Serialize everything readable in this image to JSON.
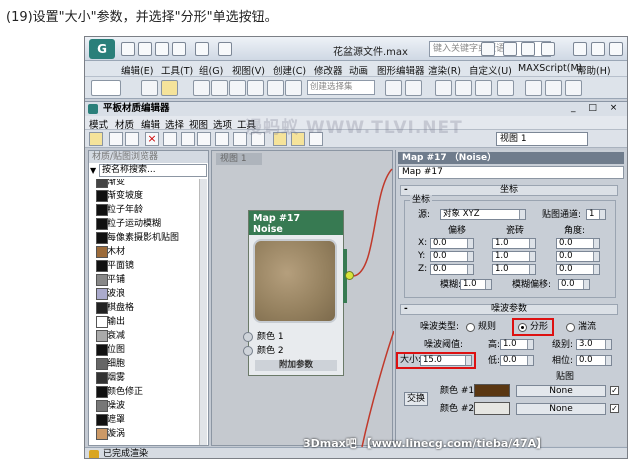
{
  "caption": "(19)设置\"大小\"参数，并选择\"分形\"单选按钮。",
  "app": {
    "logo": "G",
    "filename": "花盆源文件.max",
    "help_search_placeholder": "键入关键字或短语"
  },
  "main_menu": [
    "编辑(E)",
    "工具(T)",
    "组(G)",
    "视图(V)",
    "创建(C)",
    "修改器",
    "动画",
    "图形编辑器",
    "渲染(R)",
    "自定义(U)",
    "MAXScript(M)",
    "帮助(H)"
  ],
  "selection_set_placeholder": "创建选择集",
  "slate": {
    "title": "平板材质编辑器",
    "menu": [
      "模式",
      "材质",
      "编辑",
      "选择",
      "视图",
      "选项",
      "工具"
    ],
    "view_dropdown": "视图 1"
  },
  "browser": {
    "title": "材质/贴图浏览器",
    "search_placeholder": "按名称搜索...",
    "items": [
      {
        "label": "渐变",
        "color": "#444"
      },
      {
        "label": "渐变坡度",
        "color": "#111"
      },
      {
        "label": "粒子年龄",
        "color": "#111"
      },
      {
        "label": "粒子运动模糊",
        "color": "#111"
      },
      {
        "label": "每像素摄影机贴图",
        "color": "#111"
      },
      {
        "label": "木材",
        "color": "#9c6b3a"
      },
      {
        "label": "平面镜",
        "color": "#111"
      },
      {
        "label": "平铺",
        "color": "#888"
      },
      {
        "label": "波浪",
        "color": "#aac"
      },
      {
        "label": "棋盘格",
        "color": "#222"
      },
      {
        "label": "输出",
        "color": "#fff"
      },
      {
        "label": "衰减",
        "color": "#aaa"
      },
      {
        "label": "位图",
        "color": "#111"
      },
      {
        "label": "细胞",
        "color": "#666"
      },
      {
        "label": "烟雾",
        "color": "#333"
      },
      {
        "label": "颜色修正",
        "color": "#111"
      },
      {
        "label": "噪波",
        "color": "#777"
      },
      {
        "label": "遮罩",
        "color": "#111"
      },
      {
        "label": "漩涡",
        "color": "#c96"
      }
    ]
  },
  "node_view": {
    "tab": "视图 1"
  },
  "node": {
    "title": "Map #17",
    "subtitle": "Noise",
    "slots": [
      "颜色 1",
      "颜色 2"
    ],
    "footer": "附加参数"
  },
  "params": {
    "header": "Map #17 （Noise）",
    "map_name": "Map #17",
    "coords": {
      "rollout": "坐标",
      "group": "坐标",
      "source_label": "源:",
      "source_value": "对象 XYZ",
      "map_channel_label": "贴图通道:",
      "map_channel_value": "1",
      "col_offset": "偏移",
      "col_tiling": "瓷砖",
      "col_angle": "角度:",
      "rows": [
        {
          "axis": "X:",
          "offset": "0.0",
          "tiling": "1.0",
          "angle": "0.0"
        },
        {
          "axis": "Y:",
          "offset": "0.0",
          "tiling": "1.0",
          "angle": "0.0"
        },
        {
          "axis": "Z:",
          "offset": "0.0",
          "tiling": "1.0",
          "angle": "0.0"
        }
      ],
      "blur_label": "模糊:",
      "blur_value": "1.0",
      "blur_offset_label": "模糊偏移:",
      "blur_offset_value": "0.0"
    },
    "noise": {
      "rollout": "噪波参数",
      "type_label": "噪波类型:",
      "types": [
        "规则",
        "分形",
        "湍流"
      ],
      "selected_type": "分形",
      "threshold_label": "噪波阈值:",
      "high_label": "高:",
      "high_value": "1.0",
      "levels_label": "级别:",
      "levels_value": "3.0",
      "size_label": "大小:",
      "size_value": "15.0",
      "low_label": "低:",
      "low_value": "0.0",
      "phase_label": "相位:",
      "phase_value": "0.0",
      "maps_label": "贴图",
      "swap_button": "交换",
      "color1_label": "颜色 #1",
      "color1": "#5a3712",
      "color2_label": "颜色 #2",
      "color2": "#e6e6e2",
      "map_none": "None"
    }
  },
  "status": "已完成渲染",
  "watermarks": {
    "top": "漫蚂蚁 WWW.TLVI.NET",
    "bottom": "3Dmax吧 【www.linecg.com/tieba/47A】"
  }
}
